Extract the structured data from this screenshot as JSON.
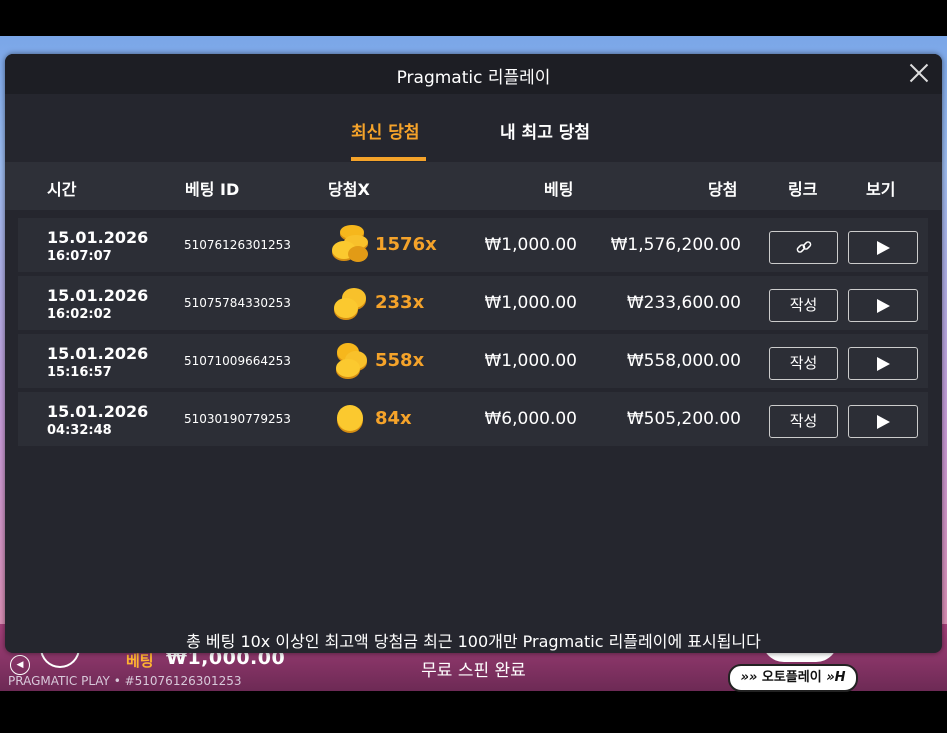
{
  "game": {
    "bet_label": "베팅",
    "bet_value": "₩1,000.00",
    "status": "무료 스핀 완료",
    "brand": "PRAGMATIC PLAY • #51076126301253",
    "autoplay_label": "오토플레이"
  },
  "dialog": {
    "title": "Pragmatic 리플레이",
    "tabs": [
      {
        "label": "최신 당첨",
        "active": true
      },
      {
        "label": "내 최고 당첨",
        "active": false
      }
    ],
    "columns": {
      "time": "시간",
      "bet_id": "베팅 ID",
      "win_x": "당첨X",
      "bet": "베팅",
      "win": "당첨",
      "link": "링크",
      "view": "보기"
    },
    "rows": [
      {
        "date": "15.01.2026",
        "time": "16:07:07",
        "bet_id": "51076126301253",
        "multiplier": "1576x",
        "bet": "₩1,000.00",
        "win": "₩1,576,200.00",
        "link_type": "chain-icon",
        "link_label": "",
        "coin_count": 4
      },
      {
        "date": "15.01.2026",
        "time": "16:02:02",
        "bet_id": "51075784330253",
        "multiplier": "233x",
        "bet": "₩1,000.00",
        "win": "₩233,600.00",
        "link_type": "text",
        "link_label": "작성",
        "coin_count": 2
      },
      {
        "date": "15.01.2026",
        "time": "15:16:57",
        "bet_id": "51071009664253",
        "multiplier": "558x",
        "bet": "₩1,000.00",
        "win": "₩558,000.00",
        "link_type": "text",
        "link_label": "작성",
        "coin_count": 3
      },
      {
        "date": "15.01.2026",
        "time": "04:32:48",
        "bet_id": "51030190779253",
        "multiplier": "84x",
        "bet": "₩6,000.00",
        "win": "₩505,200.00",
        "link_type": "text",
        "link_label": "작성",
        "coin_count": 1
      }
    ]
  },
  "footer_note": "총 베팅 10x 이상인 최고액 당첨금 최근 100개만 Pragmatic 리플레이에 표시됩니다",
  "colors": {
    "accent": "#f5a32a",
    "dialog_bg": "#25262e",
    "row_bg": "#2c2e36"
  }
}
